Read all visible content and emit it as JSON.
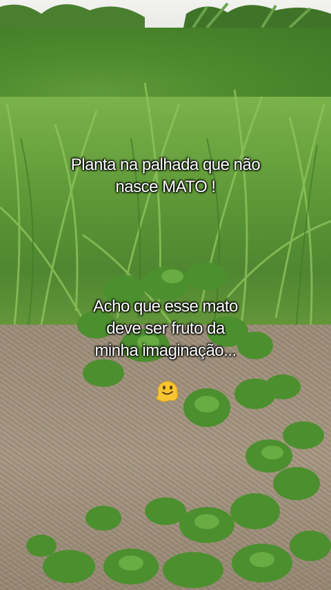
{
  "caption_top": {
    "line1": "Planta na palhada que não",
    "line2": "nasce MATO !"
  },
  "caption_bottom": {
    "line1": "Acho que esse mato",
    "line2": "deve ser fruto da",
    "line3": "minha imaginação...",
    "emoji_icon": "melting-face-emoji"
  },
  "colors": {
    "grass": "#5b9535",
    "leaf": "#4c8f2e",
    "straw": "#a89a86",
    "emoji": "#f7c531"
  }
}
